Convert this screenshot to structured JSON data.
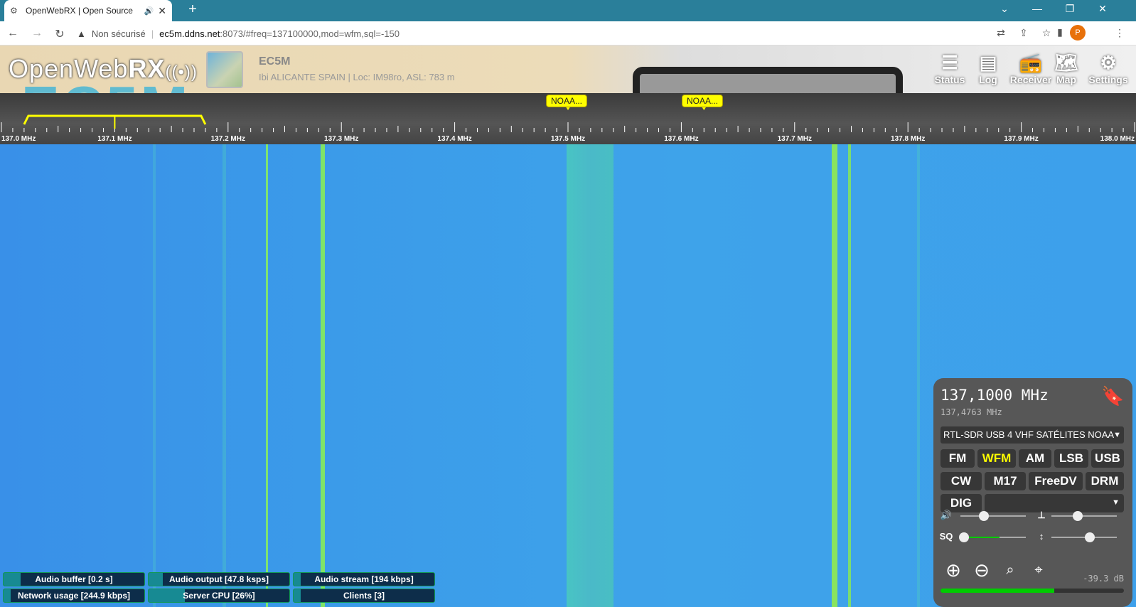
{
  "browser": {
    "tab_title": "OpenWebRX | Open Source",
    "new_tab": "+",
    "url_warning": "Non sécurisé",
    "url_host": "ec5m.ddns.net",
    "url_path": ":8073/#freq=137100000,mod=wfm,sql=-150",
    "profile_initial": "P"
  },
  "header": {
    "logo_light": "OpenWeb",
    "logo_bold": "RX",
    "logo_wave": "((•))",
    "background_text": "EC5M",
    "station_name": "EC5M",
    "station_info": "Ibi ALICANTE SPAIN | Loc: IM98ro, ASL: 783 m",
    "nav": [
      {
        "label": "Status",
        "icon": "status-icon"
      },
      {
        "label": "Log",
        "icon": "log-icon"
      },
      {
        "label": "Receiver",
        "icon": "receiver-icon"
      },
      {
        "label": "Map",
        "icon": "map-icon"
      },
      {
        "label": "Settings",
        "icon": "gear-icon"
      }
    ]
  },
  "scale": {
    "labels": [
      "137.0 MHz",
      "137.1 MHz",
      "137.2 MHz",
      "137.3 MHz",
      "137.4 MHz",
      "137.5 MHz",
      "137.6 MHz",
      "137.7 MHz",
      "137.8 MHz",
      "137.9 MHz",
      "138.0 MHz"
    ],
    "bookmarks": [
      {
        "label": "NOAA...",
        "freq_mhz": 137.5
      },
      {
        "label": "NOAA...",
        "freq_mhz": 137.62
      }
    ],
    "filter_mhz": [
      137.02,
      137.18
    ],
    "center_mhz": 137.1,
    "range_mhz": [
      137.0,
      138.0
    ],
    "filter_color": "#ffff00"
  },
  "receiver": {
    "frequency": "137,1000 MHz",
    "secondary_frequency": "137,4763 MHz",
    "profile": "RTL-SDR USB 4 VHF SATÉLITES NOAA",
    "modes_row1": [
      "FM",
      "WFM",
      "AM",
      "LSB",
      "USB"
    ],
    "modes_row2": [
      "CW",
      "M17",
      "FreeDV",
      "DRM"
    ],
    "dig_label": "DIG",
    "active_mode": "WFM",
    "volume_level": 0.3,
    "squelch_level": 0.0,
    "nr_level": 0.3,
    "agc_level": 0.55,
    "sq_label": "SQ",
    "smeter_text": "-39.3 dB",
    "smeter_level": 0.62,
    "accent": "#ffff00"
  },
  "stats": [
    {
      "label": "Audio buffer [0.2 s]",
      "level": 0.12
    },
    {
      "label": "Audio output [47.8 ksps]",
      "level": 0.1
    },
    {
      "label": "Audio stream [194 kbps]",
      "level": 0.05
    },
    {
      "label": "Network usage [244.9 kbps]",
      "level": 0.05
    },
    {
      "label": "Server CPU [26%]",
      "level": 0.26
    },
    {
      "label": "Clients [3]",
      "level": 0.05
    }
  ]
}
